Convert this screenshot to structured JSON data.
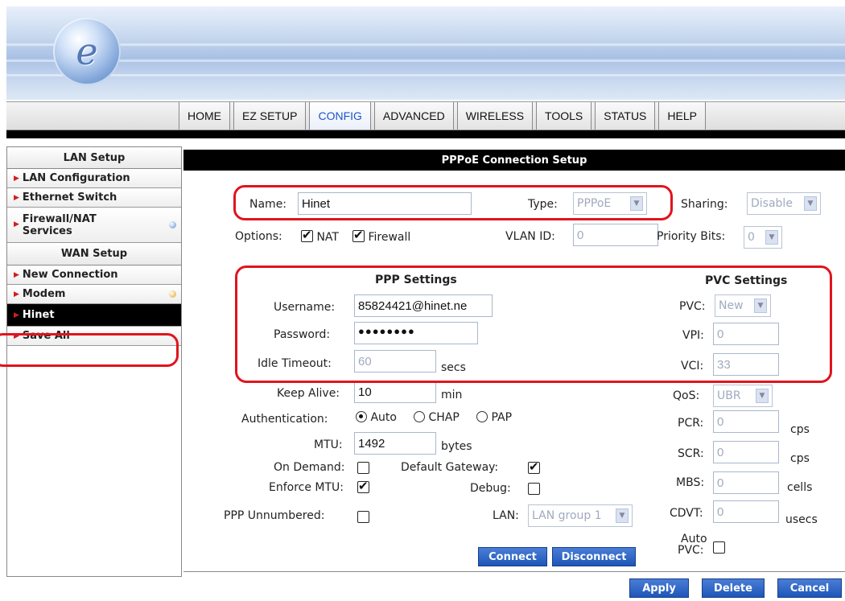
{
  "header": {
    "logo_letter": "e"
  },
  "nav": {
    "tabs": [
      "HOME",
      "EZ SETUP",
      "CONFIG",
      "ADVANCED",
      "WIRELESS",
      "TOOLS",
      "STATUS",
      "HELP"
    ],
    "active": "CONFIG"
  },
  "sidebar": {
    "lan_header": "LAN Setup",
    "lan_items": [
      "LAN Configuration",
      "Ethernet Switch",
      "Firewall/NAT Services"
    ],
    "wan_header": "WAN Setup",
    "wan_items": [
      "New Connection",
      "Modem",
      "Hinet",
      "Save All"
    ],
    "active_item": "Hinet"
  },
  "main": {
    "title": "PPPoE Connection Setup",
    "name_label": "Name:",
    "name_value": "Hinet",
    "type_label": "Type:",
    "type_value": "PPPoE",
    "sharing_label": "Sharing:",
    "sharing_value": "Disable",
    "options_label": "Options:",
    "nat_label": "NAT",
    "firewall_label": "Firewall",
    "vlan_label": "VLAN ID:",
    "vlan_value": "0",
    "priority_label": "Priority Bits:",
    "priority_value": "0",
    "ppp_settings_title": "PPP Settings",
    "pvc_settings_title": "PVC Settings",
    "username_label": "Username:",
    "username_value": "85824421@hinet.ne",
    "password_label": "Password:",
    "password_value": "●●●●●●●●",
    "idle_label": "Idle Timeout:",
    "idle_value": "60",
    "idle_unit": "secs",
    "keepalive_label": "Keep Alive:",
    "keepalive_value": "10",
    "keepalive_unit": "min",
    "auth_label": "Authentication:",
    "auth_auto": "Auto",
    "auth_chap": "CHAP",
    "auth_pap": "PAP",
    "mtu_label": "MTU:",
    "mtu_value": "1492",
    "mtu_unit": "bytes",
    "ondemand_label": "On Demand:",
    "default_gw_label": "Default Gateway:",
    "enforce_mtu_label": "Enforce MTU:",
    "debug_label": "Debug:",
    "ppp_unnumbered_label": "PPP Unnumbered:",
    "lan_label": "LAN:",
    "lan_value": "LAN group 1",
    "pvc_label": "PVC:",
    "pvc_value": "New",
    "vpi_label": "VPI:",
    "vpi_value": "0",
    "vci_label": "VCI:",
    "vci_value": "33",
    "qos_label": "QoS:",
    "qos_value": "UBR",
    "pcr_label": "PCR:",
    "pcr_value": "0",
    "pcr_unit": "cps",
    "scr_label": "SCR:",
    "scr_value": "0",
    "scr_unit": "cps",
    "mbs_label": "MBS:",
    "mbs_value": "0",
    "mbs_unit": "cells",
    "cdvt_label": "CDVT:",
    "cdvt_value": "0",
    "cdvt_unit": "usecs",
    "auto_pvc_label_1": "Auto",
    "auto_pvc_label_2": "PVC:",
    "connect_label": "Connect",
    "disconnect_label": "Disconnect"
  },
  "footer": {
    "apply_label": "Apply",
    "delete_label": "Delete",
    "cancel_label": "Cancel"
  },
  "colors": {
    "accent_blue": "#1e56b8",
    "highlight_red": "#e0141e",
    "active_tab": "#1d55c9"
  }
}
